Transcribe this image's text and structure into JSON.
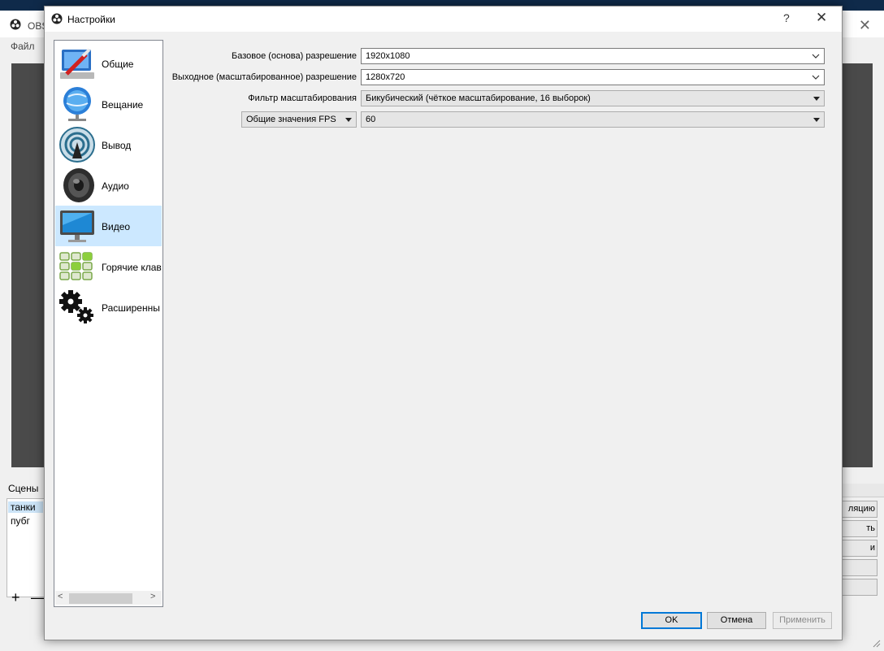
{
  "background_window": {
    "title": "OBS",
    "menu_file": "Файл",
    "scenes_label": "Сцены",
    "scenes": [
      "танки",
      "пубг"
    ],
    "right_buttons": [
      "ляцию",
      "ть",
      "и",
      "",
      ""
    ]
  },
  "dialog": {
    "title": "Настройки",
    "help": "?",
    "close": "✕"
  },
  "sidebar": {
    "items": [
      {
        "label": "Общие",
        "icon": "general-settings-icon"
      },
      {
        "label": "Вещание",
        "icon": "broadcast-globe-icon"
      },
      {
        "label": "Вывод",
        "icon": "output-antenna-icon"
      },
      {
        "label": "Аудио",
        "icon": "speaker-icon"
      },
      {
        "label": "Видео",
        "icon": "monitor-icon"
      },
      {
        "label": "Горячие клав",
        "icon": "hotkeys-keyboard-icon"
      },
      {
        "label": "Расширенны",
        "icon": "advanced-gears-icon"
      }
    ],
    "active_index": 4
  },
  "video": {
    "base_resolution_label": "Базовое (основа) разрешение",
    "base_resolution_value": "1920x1080",
    "output_resolution_label": "Выходное (масштабированное) разрешение",
    "output_resolution_value": "1280x720",
    "downscale_filter_label": "Фильтр масштабирования",
    "downscale_filter_value": "Бикубический (чёткое масштабирование, 16 выборок)",
    "fps_type_value": "Общие значения FPS",
    "fps_value": "60"
  },
  "buttons": {
    "ok": "OK",
    "cancel": "Отмена",
    "apply": "Применить"
  },
  "colors": {
    "active_nav": "#cce8ff",
    "default_button_border": "#0078d7"
  }
}
